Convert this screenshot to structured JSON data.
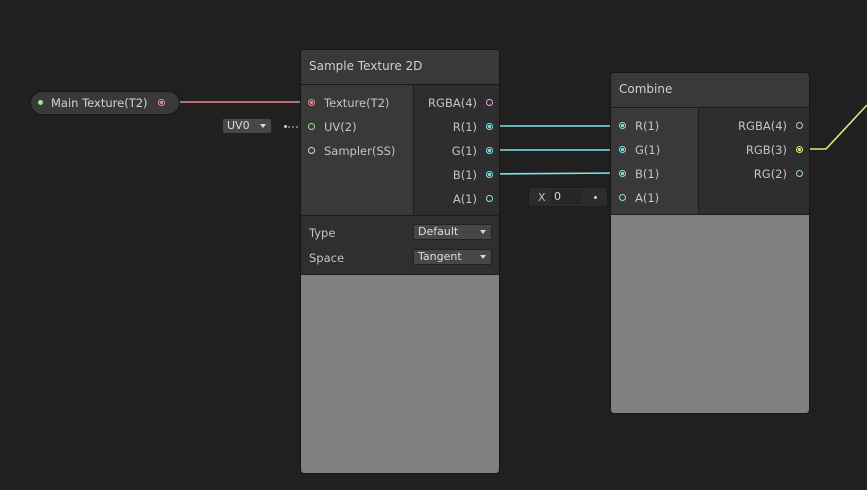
{
  "property_node": {
    "label": "Main Texture(T2)"
  },
  "uv_dropdown": {
    "value": "UV0"
  },
  "sample_node": {
    "title": "Sample Texture 2D",
    "inputs": [
      "Texture(T2)",
      "UV(2)",
      "Sampler(SS)"
    ],
    "outputs": [
      "RGBA(4)",
      "R(1)",
      "G(1)",
      "B(1)",
      "A(1)"
    ],
    "settings": [
      {
        "label": "Type",
        "value": "Default"
      },
      {
        "label": "Space",
        "value": "Tangent"
      }
    ]
  },
  "a_default": {
    "axis": "X",
    "value": "0"
  },
  "combine_node": {
    "title": "Combine",
    "inputs": [
      "R(1)",
      "G(1)",
      "B(1)",
      "A(1)"
    ],
    "outputs": [
      "RGBA(4)",
      "RGB(3)",
      "RG(2)"
    ]
  },
  "colors": {
    "texture_wire": "#f0868a",
    "float_wire": "#7fe6e6",
    "vector3_wire": "#e6e680",
    "vector2_port": "#9ae690",
    "vector4_port": "#e6a5e6",
    "background": "#202020",
    "preview": "#808080"
  }
}
